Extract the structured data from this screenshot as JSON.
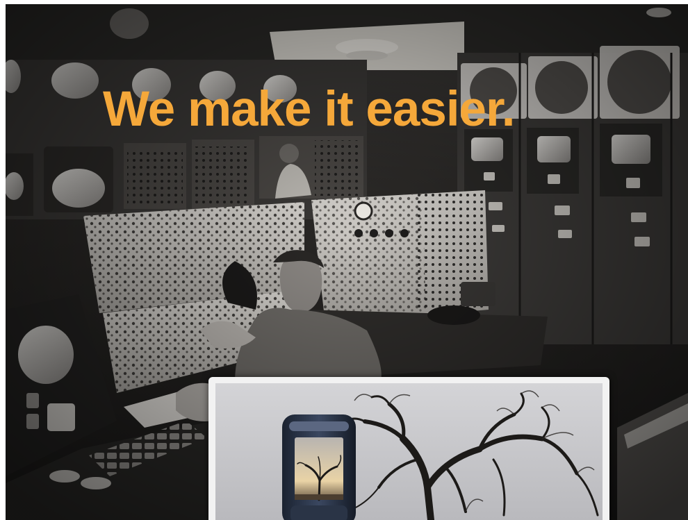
{
  "headline": {
    "text": "We make it easier.",
    "color": "#f5a83a"
  },
  "background_photo": {
    "subject": "vintage-computer-control-room",
    "tone": "sepia-monochrome"
  },
  "inset_photo": {
    "subject": "phone-photographing-tree",
    "sky_color": "#c9c9cc"
  }
}
